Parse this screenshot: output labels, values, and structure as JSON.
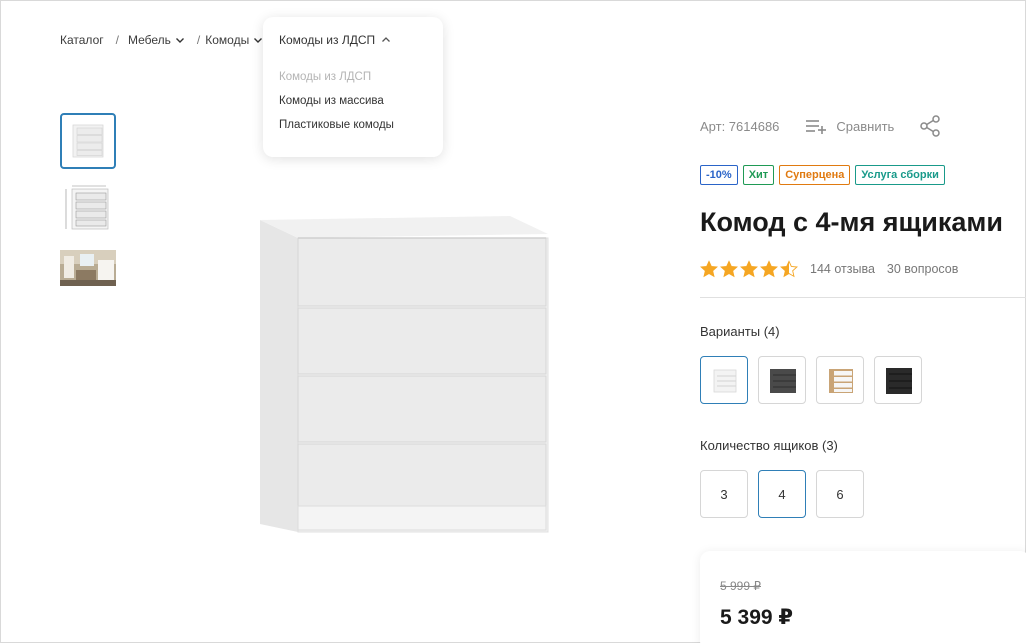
{
  "breadcrumb": {
    "items": [
      {
        "label": "Каталог",
        "has_chevron": false
      },
      {
        "label": "Мебель",
        "has_chevron": true
      },
      {
        "label": "Комоды",
        "has_chevron": true
      }
    ],
    "separator": "/"
  },
  "dropdown": {
    "current": "Комоды из ЛДСП",
    "items": [
      "Комоды из ЛДСП",
      "Комоды из массива",
      "Пластиковые комоды"
    ],
    "disabled_index": 0
  },
  "gallery": {
    "thumbnails": [
      "white-chest-front",
      "dimensions-drawing",
      "interior-photo"
    ],
    "active_index": 0
  },
  "product": {
    "article": "Арт: 7614686",
    "compare_label": "Сравнить",
    "badges": [
      {
        "label": "-10%",
        "color": "#2a64c8"
      },
      {
        "label": "Хит",
        "color": "#1f9a55"
      },
      {
        "label": "Суперцена",
        "color": "#e07a10"
      },
      {
        "label": "Услуга сборки",
        "color": "#199a8a"
      }
    ],
    "title": "Комод с 4-мя ящиками",
    "rating": 4.5,
    "rating_max": 5,
    "reviews_label": "144 отзыва",
    "questions_label": "30 вопросов"
  },
  "variants": {
    "label": "Варианты (4)",
    "items": [
      "white",
      "dark-grey",
      "oak-white",
      "black"
    ],
    "active_index": 0
  },
  "drawers": {
    "label": "Количество ящиков (3)",
    "options": [
      "3",
      "4",
      "6"
    ],
    "active_index": 1
  },
  "price": {
    "old": "5 999 ₽",
    "current": "5 399 ₽"
  },
  "colors": {
    "accent": "#2f7fb7",
    "star": "#f5a623"
  }
}
